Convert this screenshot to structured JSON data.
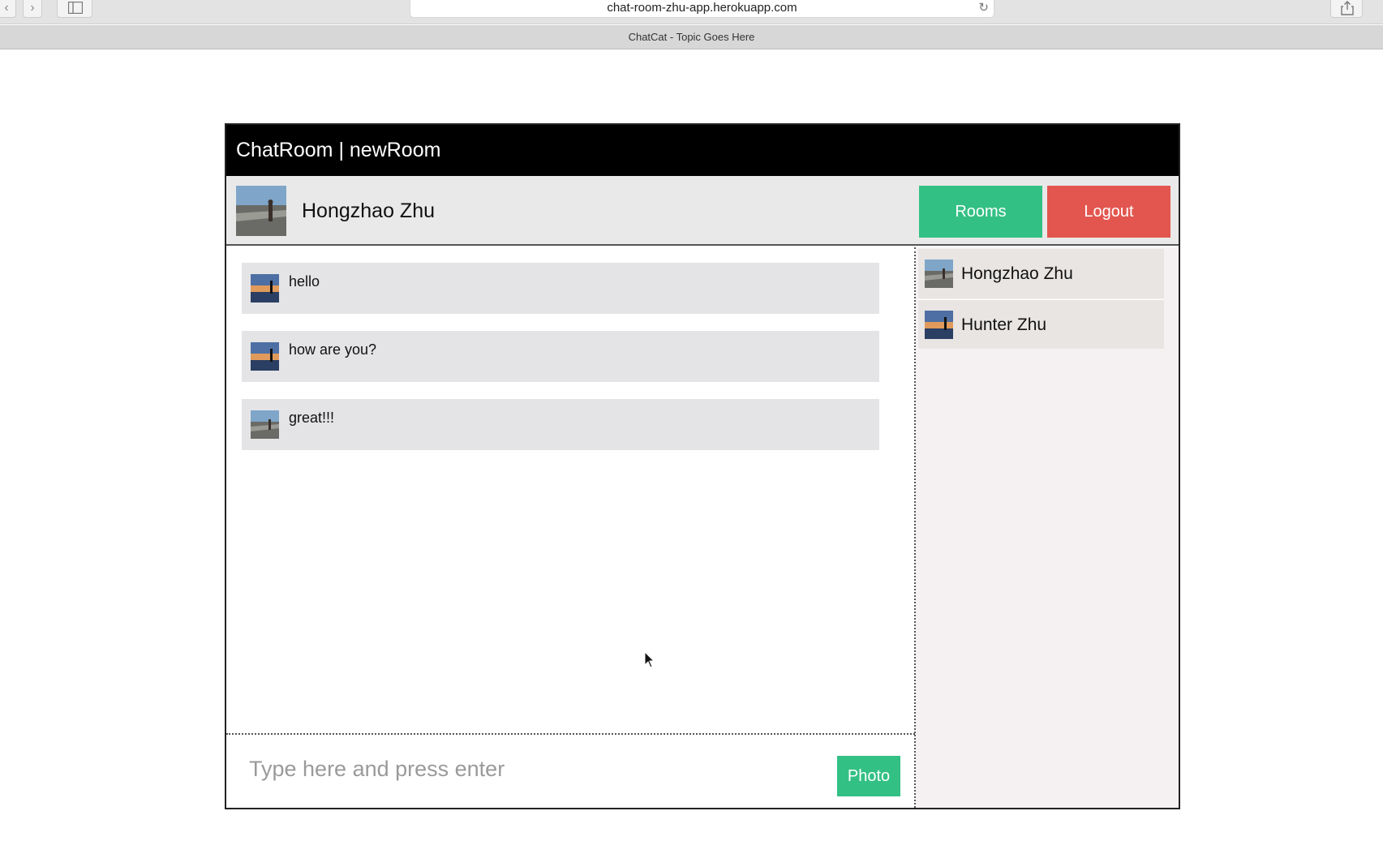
{
  "browser": {
    "url": "chat-room-zhu-app.herokuapp.com",
    "tab_title": "ChatCat - Topic Goes Here"
  },
  "app": {
    "title": "ChatRoom | newRoom",
    "current_user": "Hongzhao Zhu",
    "rooms_label": "Rooms",
    "logout_label": "Logout"
  },
  "messages": [
    {
      "text": "hello"
    },
    {
      "text": "how are you?"
    },
    {
      "text": "great!!!"
    }
  ],
  "composer": {
    "placeholder": "Type here and press enter",
    "photo_label": "Photo"
  },
  "users": [
    {
      "name": "Hongzhao Zhu"
    },
    {
      "name": "Hunter Zhu"
    }
  ],
  "colors": {
    "rooms_button": "#33c084",
    "logout_button": "#e2564f",
    "header": "#000000"
  }
}
